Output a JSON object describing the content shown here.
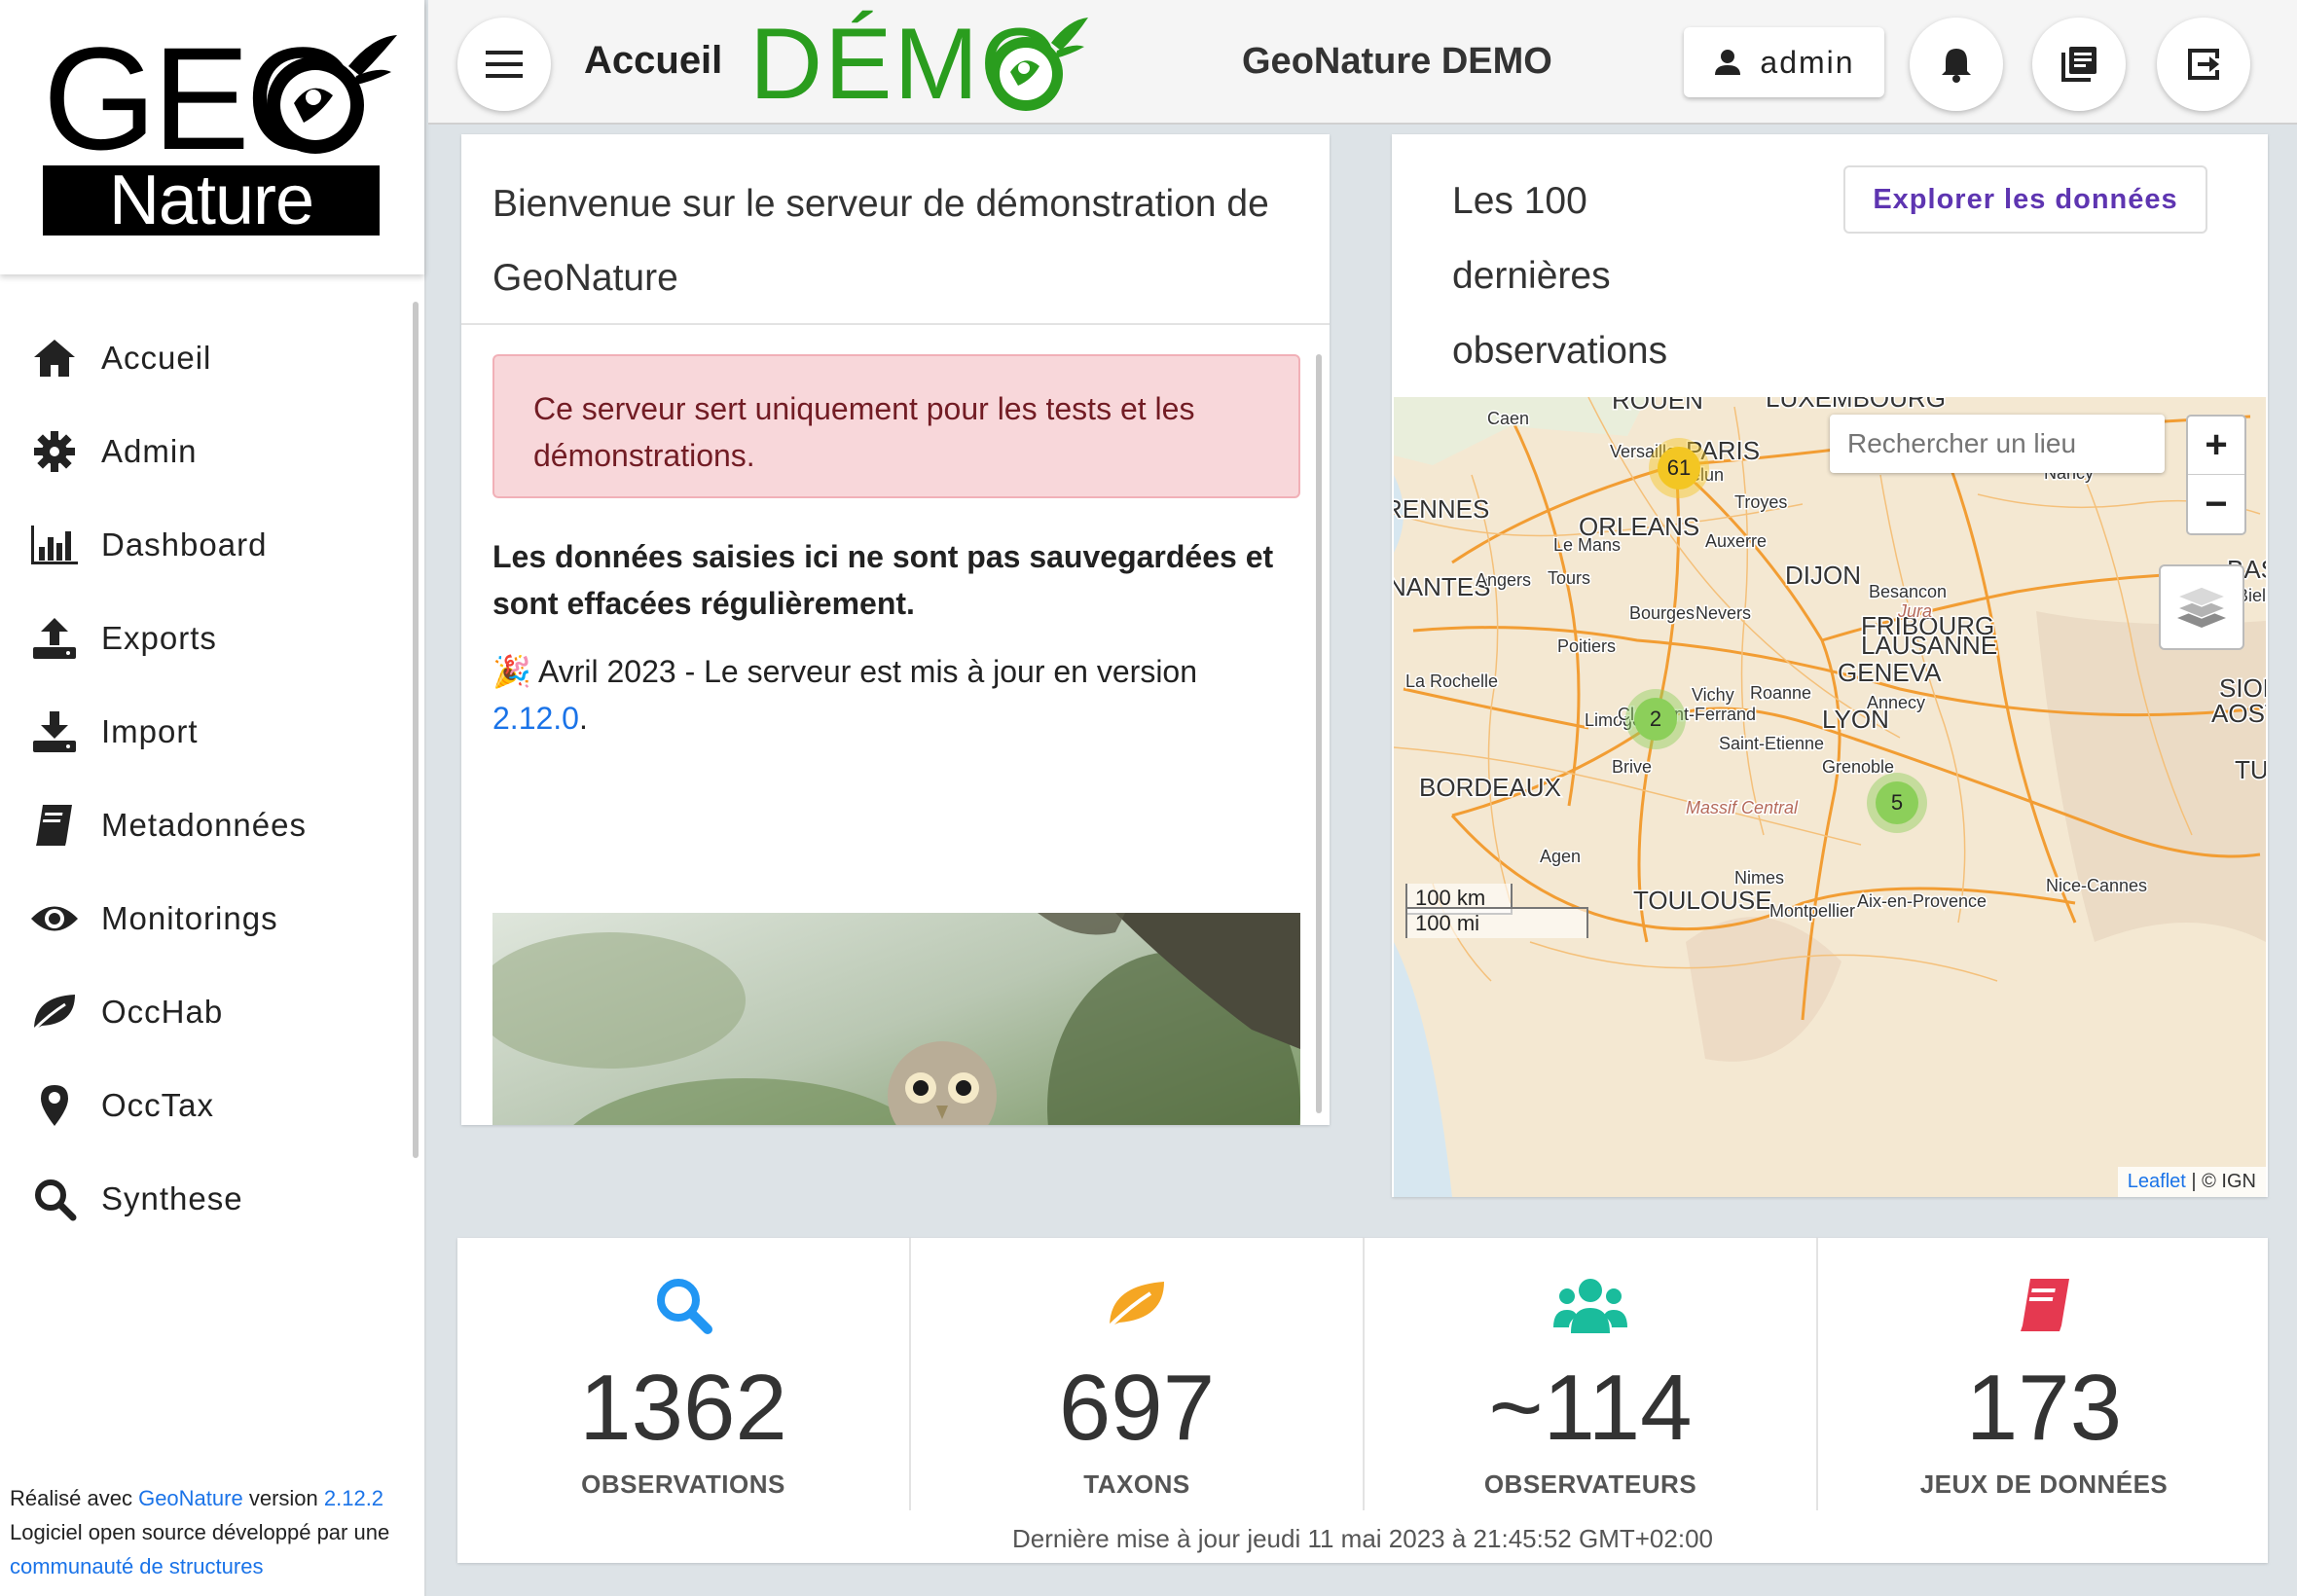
{
  "brand": {
    "geo": "GEO",
    "nature": "Nature"
  },
  "sidebar": {
    "items": [
      {
        "label": "Accueil",
        "icon": "home-icon"
      },
      {
        "label": "Admin",
        "icon": "gear-icon"
      },
      {
        "label": "Dashboard",
        "icon": "bar-chart-icon"
      },
      {
        "label": "Exports",
        "icon": "upload-icon"
      },
      {
        "label": "Import",
        "icon": "download-icon"
      },
      {
        "label": "Metadonnées",
        "icon": "book-icon"
      },
      {
        "label": "Monitorings",
        "icon": "eye-icon"
      },
      {
        "label": "OccHab",
        "icon": "leaf-icon"
      },
      {
        "label": "OccTax",
        "icon": "map-pin-icon"
      },
      {
        "label": "Synthese",
        "icon": "search-icon"
      }
    ],
    "footer": {
      "made_with": "Réalisé avec",
      "geonature_link": "GeoNature",
      "version_word": "version",
      "version": "2.12.2",
      "open_source": "Logiciel open source développé par une",
      "community_link": "communauté de structures"
    }
  },
  "topbar": {
    "title": "Accueil",
    "demo": "DÉMO",
    "site_name": "GeoNature DEMO",
    "user": "admin"
  },
  "welcome": {
    "heading": "Bienvenue sur le serveur de démonstration de GeoNature",
    "alert": "Ce serveur sert uniquement pour les tests et les démonstrations.",
    "bold_note": "Les données saisies ici ne sont pas sauvegardées et sont effacées régulièrement.",
    "news_emoji": "🎉",
    "news_text": "Avril 2023 - Le serveur est mis à jour en version",
    "news_link": "2.12.0",
    "news_end": "."
  },
  "map": {
    "title": "Les 100 dernières observations",
    "explore": "Explorer les données",
    "search_placeholder": "Rechercher un lieu",
    "zoom_in": "+",
    "zoom_out": "−",
    "clusters": [
      {
        "count": "61"
      },
      {
        "count": "2"
      },
      {
        "count": "5"
      }
    ],
    "cities": [
      "ROUEN",
      "LUXEMBOURG",
      "Caen",
      "Versailles",
      "PARIS",
      "Melun",
      "Nancy",
      "Troyes",
      "RENNES",
      "ORLEANS",
      "Le Mans",
      "Auxerre",
      "NANTES",
      "Angers",
      "Tours",
      "DIJON",
      "Besancon",
      "BASEL",
      "Bourges",
      "Nevers",
      "FRIBOURG",
      "LAUSANNE",
      "Poitiers",
      "GENEVA",
      "La Rochelle",
      "Vichy",
      "Roanne",
      "Annecy",
      "SION",
      "AOSTA",
      "Limoges",
      "Clermont-Ferrand",
      "LYON",
      "Saint-Etienne",
      "Brive",
      "Grenoble",
      "BORDEAUX",
      "Massif Central",
      "TURIN",
      "Agen",
      "Nimes",
      "Nice-Cannes",
      "TOULOUSE",
      "Montpellier",
      "Aix-en-Provence",
      "Biel",
      "Jura"
    ],
    "scale_km": "100 km",
    "scale_mi": "100 mi",
    "attrib_link": "Leaflet",
    "attrib_rest": "| © IGN"
  },
  "stats": [
    {
      "value": "1362",
      "label": "OBSERVATIONS",
      "icon": "search-icon",
      "color": "#2196f3"
    },
    {
      "value": "697",
      "label": "TAXONS",
      "icon": "leaf-icon",
      "color": "#f5a623"
    },
    {
      "value": "~114",
      "label": "OBSERVATEURS",
      "icon": "users-icon",
      "color": "#1abc9c"
    },
    {
      "value": "173",
      "label": "JEUX DE DONNÉES",
      "icon": "book-icon",
      "color": "#e53950"
    }
  ],
  "updated": "Dernière mise à jour jeudi 11 mai 2023 à 21:45:52 GMT+02:00",
  "colors": {
    "demo_green": "#2a9d1e",
    "link_blue": "#1a73e8",
    "explore_purple": "#5e35b1",
    "alert_bg": "#f8d7da",
    "cluster_yellow": "#f3c623",
    "cluster_green": "#8ccf5a"
  }
}
